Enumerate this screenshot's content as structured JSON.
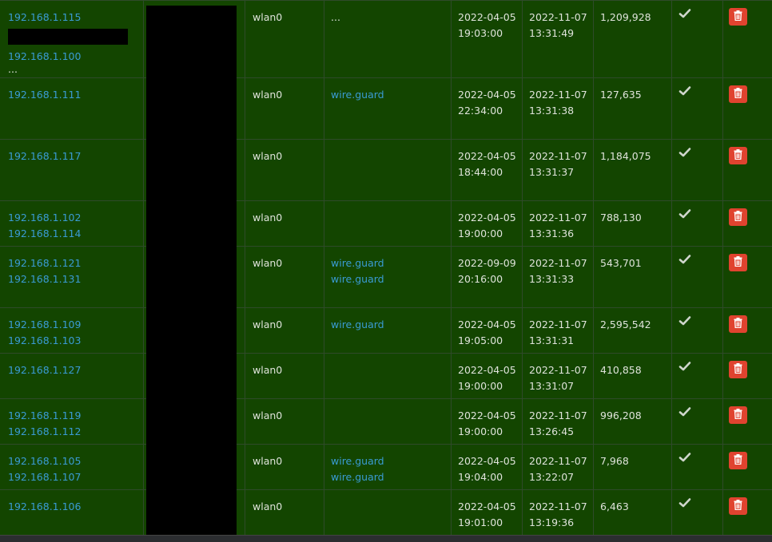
{
  "rows": [
    {
      "ips": [
        "192.168.1.115",
        "192.168.1.100"
      ],
      "ip_redacted": true,
      "ip_more": "...",
      "interface": "wlan0",
      "hostnames": [
        "..."
      ],
      "hostnames_are_links": false,
      "first_seen": [
        "2022-04-05",
        "19:03:00"
      ],
      "last_seen": [
        "2022-11-07",
        "13:31:49"
      ],
      "count": "1,209,928",
      "status_icon": "check-icon",
      "action_icon": "trash-icon"
    },
    {
      "ips": [
        "192.168.1.111"
      ],
      "interface": "wlan0",
      "hostnames": [
        "wire.guard"
      ],
      "hostnames_are_links": true,
      "first_seen": [
        "2022-04-05",
        "22:34:00"
      ],
      "last_seen": [
        "2022-11-07",
        "13:31:38"
      ],
      "count": "127,635",
      "status_icon": "check-icon",
      "action_icon": "trash-icon"
    },
    {
      "ips": [
        "192.168.1.117"
      ],
      "interface": "wlan0",
      "hostnames": [],
      "first_seen": [
        "2022-04-05",
        "18:44:00"
      ],
      "last_seen": [
        "2022-11-07",
        "13:31:37"
      ],
      "count": "1,184,075",
      "status_icon": "check-icon",
      "action_icon": "trash-icon"
    },
    {
      "ips": [
        "192.168.1.102",
        "192.168.1.114"
      ],
      "interface": "wlan0",
      "hostnames": [],
      "first_seen": [
        "2022-04-05",
        "19:00:00"
      ],
      "last_seen": [
        "2022-11-07",
        "13:31:36"
      ],
      "count": "788,130",
      "status_icon": "check-icon",
      "action_icon": "trash-icon"
    },
    {
      "ips": [
        "192.168.1.121",
        "192.168.1.131"
      ],
      "interface": "wlan0",
      "hostnames": [
        "wire.guard",
        "wire.guard"
      ],
      "hostnames_are_links": true,
      "first_seen": [
        "2022-09-09",
        "20:16:00"
      ],
      "last_seen": [
        "2022-11-07",
        "13:31:33"
      ],
      "count": "543,701",
      "status_icon": "check-icon",
      "action_icon": "trash-icon"
    },
    {
      "ips": [
        "192.168.1.109",
        "192.168.1.103"
      ],
      "interface": "wlan0",
      "hostnames": [
        "wire.guard"
      ],
      "hostnames_are_links": true,
      "first_seen": [
        "2022-04-05",
        "19:05:00"
      ],
      "last_seen": [
        "2022-11-07",
        "13:31:31"
      ],
      "count": "2,595,542",
      "status_icon": "check-icon",
      "action_icon": "trash-icon"
    },
    {
      "ips": [
        "192.168.1.127"
      ],
      "interface": "wlan0",
      "hostnames": [],
      "first_seen": [
        "2022-04-05",
        "19:00:00"
      ],
      "last_seen": [
        "2022-11-07",
        "13:31:07"
      ],
      "count": "410,858",
      "status_icon": "check-icon",
      "action_icon": "trash-icon"
    },
    {
      "ips": [
        "192.168.1.119",
        "192.168.1.112"
      ],
      "interface": "wlan0",
      "hostnames": [],
      "first_seen": [
        "2022-04-05",
        "19:00:00"
      ],
      "last_seen": [
        "2022-11-07",
        "13:26:45"
      ],
      "count": "996,208",
      "status_icon": "check-icon",
      "action_icon": "trash-icon"
    },
    {
      "ips": [
        "192.168.1.105",
        "192.168.1.107"
      ],
      "interface": "wlan0",
      "hostnames": [
        "wire.guard",
        "wire.guard"
      ],
      "hostnames_are_links": true,
      "first_seen": [
        "2022-04-05",
        "19:04:00"
      ],
      "last_seen": [
        "2022-11-07",
        "13:22:07"
      ],
      "count": "7,968",
      "status_icon": "check-icon",
      "action_icon": "trash-icon"
    },
    {
      "ips": [
        "192.168.1.106"
      ],
      "interface": "wlan0",
      "hostnames": [],
      "first_seen": [
        "2022-04-05",
        "19:01:00"
      ],
      "last_seen": [
        "2022-11-07",
        "13:19:36"
      ],
      "count": "6,463",
      "status_icon": "check-icon",
      "action_icon": "trash-icon"
    }
  ],
  "colors": {
    "row_bg": "#134500",
    "link": "#3a9bd4",
    "delete_button": "#e0432f",
    "redaction": "#000000"
  }
}
